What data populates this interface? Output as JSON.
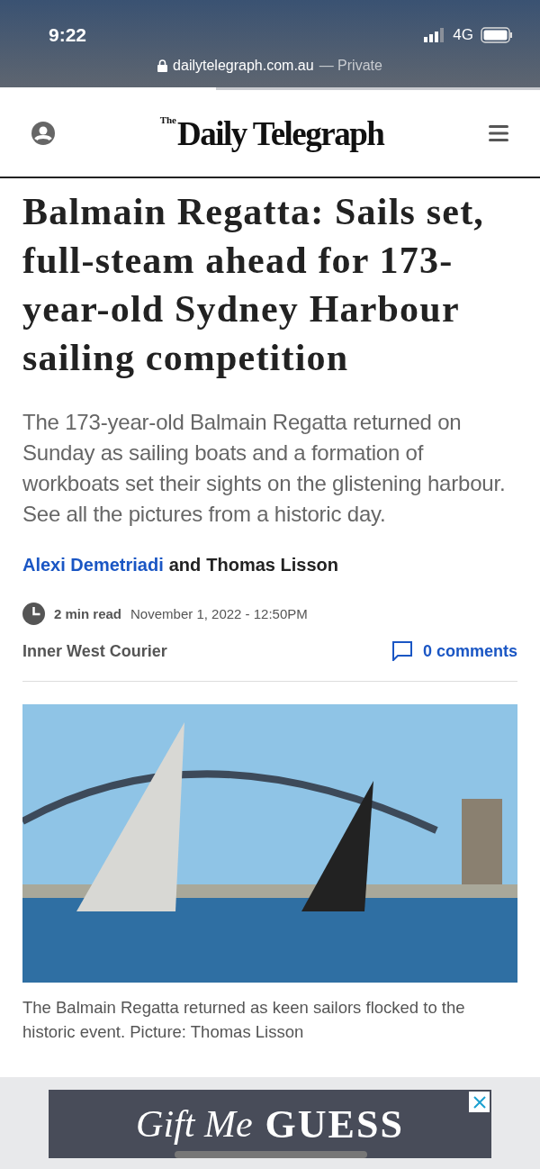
{
  "status_bar": {
    "time": "9:22",
    "network": "4G"
  },
  "browser": {
    "url": "dailytelegraph.com.au",
    "mode": "— Private",
    "loading": {
      "level": 0.4
    }
  },
  "header": {
    "logo_small": "The",
    "logo": "Daily Telegraph"
  },
  "article": {
    "headline": "Balmain Regatta: Sails set, full-steam ahead for 173-year-old Sydney Harbour sailing competition",
    "lede": "The 173-year-old Balmain Regatta returned on Sunday as sailing boats and a formation of workboats set their sights on the glistening harbour. See all the pictures from a historic day.",
    "authors": [
      {
        "name": "Alexi Demetriadi",
        "link": true
      },
      {
        "name": "Thomas Lisson",
        "link": false
      }
    ],
    "author_joiner": "and",
    "read_time": "2 min read",
    "date": "November 1, 2022 - 12:50PM",
    "source": "Inner West Courier",
    "comments": "0 comments",
    "caption": "The Balmain Regatta returned as keen sailors flocked to the historic event. Picture: Thomas Lisson"
  },
  "ad": {
    "script_text": "Gift Me",
    "brand": "GUESS"
  }
}
